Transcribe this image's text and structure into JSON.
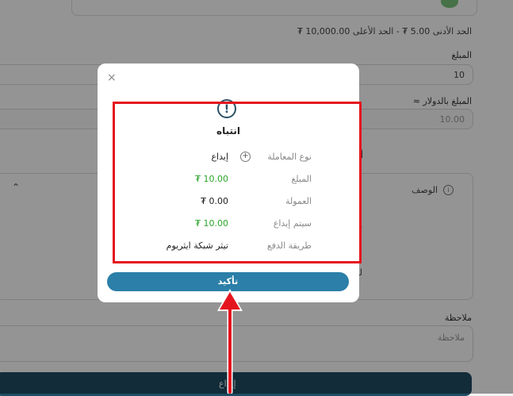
{
  "background": {
    "limits_text": "الحد الأدنى 5.00 ₮ - الحد الأعلى 10,000.00 ₮",
    "amount_label": "المبلغ",
    "amount_value": "10",
    "usd_label": "المبلغ بالدولار ≈",
    "usd_value": "10.00",
    "deposit_heading": "أيداع عن طريق شبكة ايثريوم",
    "description_title": "الوصف",
    "desc_line1": "يرجى التأكد من إرسال المبلغ",
    "desc_line2": "طريقة الدفع هذه تعمل ت",
    "desc_line3": "لمنع أي تأخير أو إلغاء الطلب",
    "note_label": "ملاحظة",
    "note_placeholder": "ملاحظة",
    "submit_label": "إيداع"
  },
  "modal": {
    "close_symbol": "×",
    "alert_symbol": "!",
    "title": "انتباه",
    "rows": [
      {
        "key": "نوع المعاملة",
        "value": "إيداع"
      },
      {
        "key": "المبلغ",
        "value": "10.00 ₮"
      },
      {
        "key": "العمولة",
        "value": "0.00 ₮"
      },
      {
        "key": "سيتم إيداع",
        "value": "10.00 ₮"
      },
      {
        "key": "طريقة الدفع",
        "value": "تيثر شبكة ايثريوم"
      }
    ],
    "confirm_label": "تأكيد"
  },
  "colors": {
    "accent": "#2b7fa8",
    "highlight": "#e4151e",
    "positive": "#2aa52a",
    "header_dark": "#1f4d63"
  }
}
